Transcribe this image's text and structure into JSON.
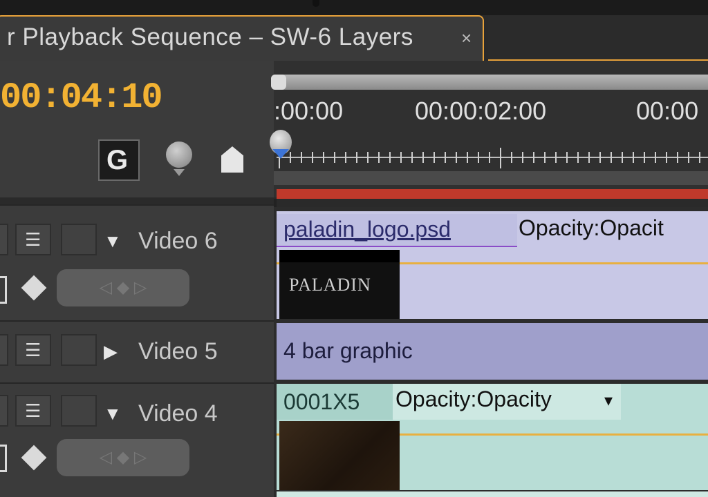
{
  "sequence_tab": {
    "title": "r Playback Sequence – SW-6 Layers",
    "close_label": "×"
  },
  "timeline": {
    "current_timecode": "00:04:10",
    "ruler_labels": [
      ":00:00",
      "00:00:02:00",
      "00:00"
    ],
    "snap_icon": "G",
    "tools": {
      "snap": "snap-icon",
      "set_marker": "marker-icon",
      "keyframe": "keyframe-icon"
    },
    "work_area_color": "#c0392b",
    "playhead_color": "#3d74d6"
  },
  "tracks": [
    {
      "name": "Video 6",
      "expanded": true,
      "twirl": "▼",
      "clip_name": "paladin_logo.psd",
      "clip_effect": "Opacity:Opacit",
      "thumbnail_text": "PALADIN",
      "clip_color": "#c8c8e6"
    },
    {
      "name": "Video 5",
      "expanded": false,
      "twirl": "▶",
      "clip_name": "4 bar graphic",
      "clip_color": "#9f9fcb"
    },
    {
      "name": "Video 4",
      "expanded": true,
      "twirl": "▼",
      "clip_name": "0001X5",
      "clip_effect": "Opacity:Opacity",
      "effect_menu": "▾",
      "clip_color": "#b8ddd6"
    }
  ],
  "track_icons": {
    "sync_lock": "☰",
    "keyframe_nav": "◁ ◆ ▷"
  },
  "accent_color": "#f2b233"
}
